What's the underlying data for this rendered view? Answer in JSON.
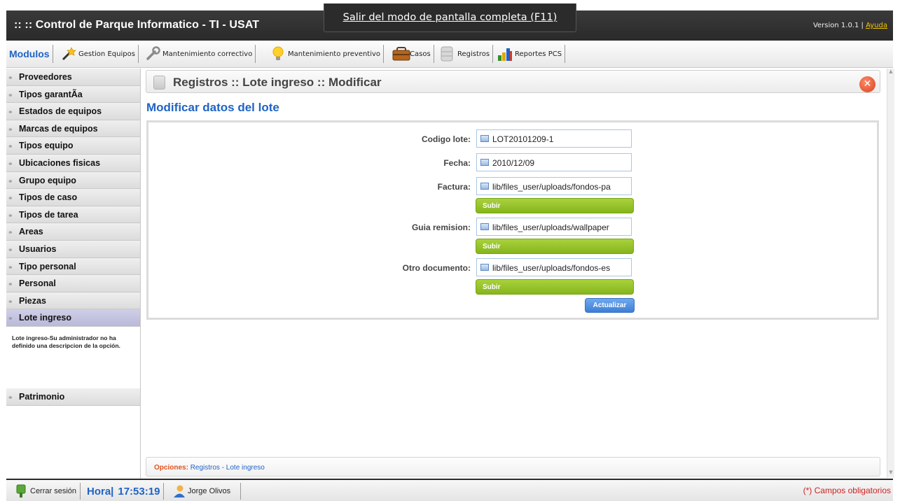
{
  "app": {
    "title": ":: :: Control de Parque Informatico - TI - USAT",
    "version": "Version 1.0.1 |",
    "help_link": "Ayuda",
    "fullscreen_notice": "Salir del modo de pantalla completa (F11)"
  },
  "modules": {
    "label": "Modulos",
    "items": [
      {
        "label": "Gestion Equipos",
        "icon": "magic-wand-icon"
      },
      {
        "label": "Mantenimiento correctivo",
        "icon": "wrench-icon"
      },
      {
        "label": "Mantenimiento preventivo",
        "icon": "lightbulb-icon"
      },
      {
        "label": "Casos",
        "icon": "briefcase-icon"
      },
      {
        "label": "Registros",
        "icon": "database-icon"
      },
      {
        "label": "Reportes PCS",
        "icon": "bar-chart-icon"
      }
    ]
  },
  "sidebar": {
    "items": [
      {
        "label": "Proveedores"
      },
      {
        "label": "Tipos garantÃa"
      },
      {
        "label": "Estados de equipos"
      },
      {
        "label": "Marcas de equipos"
      },
      {
        "label": "Tipos equipo"
      },
      {
        "label": "Ubicaciones fisicas"
      },
      {
        "label": "Grupo equipo"
      },
      {
        "label": "Tipos de caso"
      },
      {
        "label": "Tipos de tarea"
      },
      {
        "label": "Areas"
      },
      {
        "label": "Usuarios"
      },
      {
        "label": "Tipo personal"
      },
      {
        "label": "Personal"
      },
      {
        "label": "Piezas"
      },
      {
        "label": "Lote ingreso",
        "active": true
      }
    ],
    "active_description": "Lote ingreso-Su administrador no ha definido una descripcion de la opción.",
    "after_items": [
      {
        "label": "Patrimonio"
      }
    ]
  },
  "page": {
    "title": "Registros :: Lote ingreso :: Modificar",
    "section_title": "Modificar datos del lote"
  },
  "form": {
    "codigo_label": "Codigo lote:",
    "codigo_value": "LOT20101209-1",
    "fecha_label": "Fecha:",
    "fecha_value": "2010/12/09",
    "factura_label": "Factura:",
    "factura_value": "lib/files_user/uploads/fondos-pa",
    "guia_label": "Guia remision:",
    "guia_value": "lib/files_user/uploads/wallpaper",
    "otro_label": "Otro documento:",
    "otro_value": "lib/files_user/uploads/fondos-es",
    "upload_label": "Subir",
    "submit_label": "Actualizar"
  },
  "options_bar": {
    "label": "Opciones:",
    "links": "Registros - Lote ingreso"
  },
  "footer": {
    "logout_label": "Cerrar sesión",
    "hora_label": "Hora|",
    "hora_value": "17:53:19",
    "user_name": "Jorge Olivos",
    "required_note": "(*) Campos obligatorios"
  },
  "colors": {
    "accent": "#1f63c4",
    "titlebar": "#2f2f2f",
    "upload_green": "#94c22a",
    "submit_blue": "#4a8be0",
    "required_red": "#d02020"
  }
}
